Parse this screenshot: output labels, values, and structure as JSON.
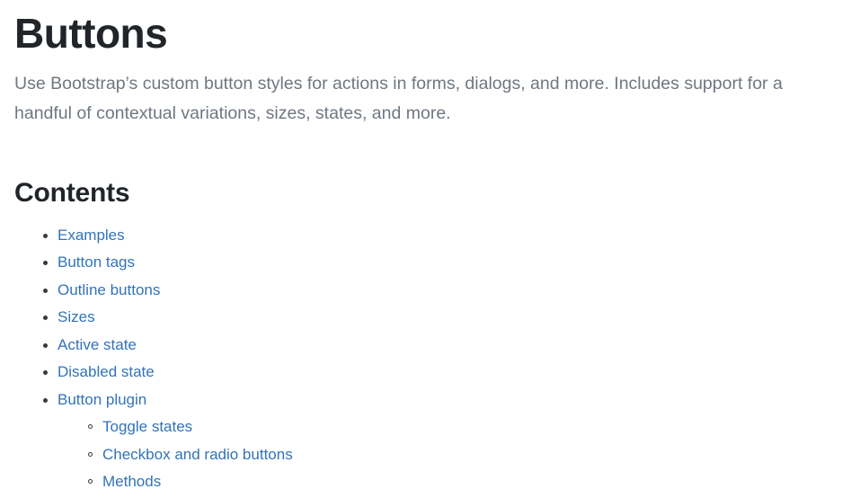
{
  "page": {
    "title": "Buttons",
    "lead": "Use Bootstrap’s custom button styles for actions in forms, dialogs, and more. Includes support for a handful of contextual variations, sizes, states, and more."
  },
  "contents": {
    "heading": "Contents",
    "items": [
      {
        "label": "Examples"
      },
      {
        "label": "Button tags"
      },
      {
        "label": "Outline buttons"
      },
      {
        "label": "Sizes"
      },
      {
        "label": "Active state"
      },
      {
        "label": "Disabled state"
      },
      {
        "label": "Button plugin",
        "children": [
          {
            "label": "Toggle states"
          },
          {
            "label": "Checkbox and radio buttons"
          },
          {
            "label": "Methods"
          }
        ]
      }
    ]
  },
  "colors": {
    "link": "#3273b8",
    "title": "#212529",
    "lead": "#6f7780",
    "bullet": "#343a40",
    "background": "#ffffff"
  }
}
